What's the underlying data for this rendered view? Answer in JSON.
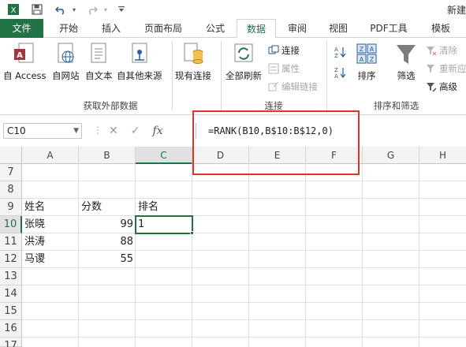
{
  "title_bar": {
    "title": "新建"
  },
  "tabs": [
    {
      "label": "文件"
    },
    {
      "label": "开始"
    },
    {
      "label": "插入"
    },
    {
      "label": "页面布局"
    },
    {
      "label": "公式"
    },
    {
      "label": "数据"
    },
    {
      "label": "审阅"
    },
    {
      "label": "视图"
    },
    {
      "label": "PDF工具"
    },
    {
      "label": "模板"
    }
  ],
  "ribbon": {
    "external": {
      "from_access": "自 Access",
      "from_web": "自网站",
      "from_text": "自文本",
      "from_other": "自其他来源",
      "existing": "现有连接",
      "group": "获取外部数据"
    },
    "connections": {
      "refresh_all": "全部刷新",
      "connections": "连接",
      "properties": "属性",
      "edit_links": "编辑链接",
      "group": "连接"
    },
    "sort_filter": {
      "sort": "排序",
      "filter": "筛选",
      "clear": "清除",
      "reapply": "重新应",
      "advanced": "高级",
      "group": "排序和筛选"
    }
  },
  "formula_bar": {
    "name_box": "C10",
    "formula": "=RANK(B10,B$10:B$12,0)",
    "fx": "fx"
  },
  "grid": {
    "columns": [
      "A",
      "B",
      "C",
      "D",
      "E",
      "F",
      "G",
      "H"
    ],
    "rows": [
      "7",
      "8",
      "9",
      "10",
      "11",
      "12",
      "13",
      "14",
      "15",
      "16",
      "17"
    ],
    "cells": {
      "a9": "姓名",
      "b9": "分数",
      "c9": "排名",
      "a10": "张晓",
      "b10": "99",
      "c10": "1",
      "a11": "洪涛",
      "b11": "88",
      "a12": "马谡",
      "b12": "55"
    }
  }
}
